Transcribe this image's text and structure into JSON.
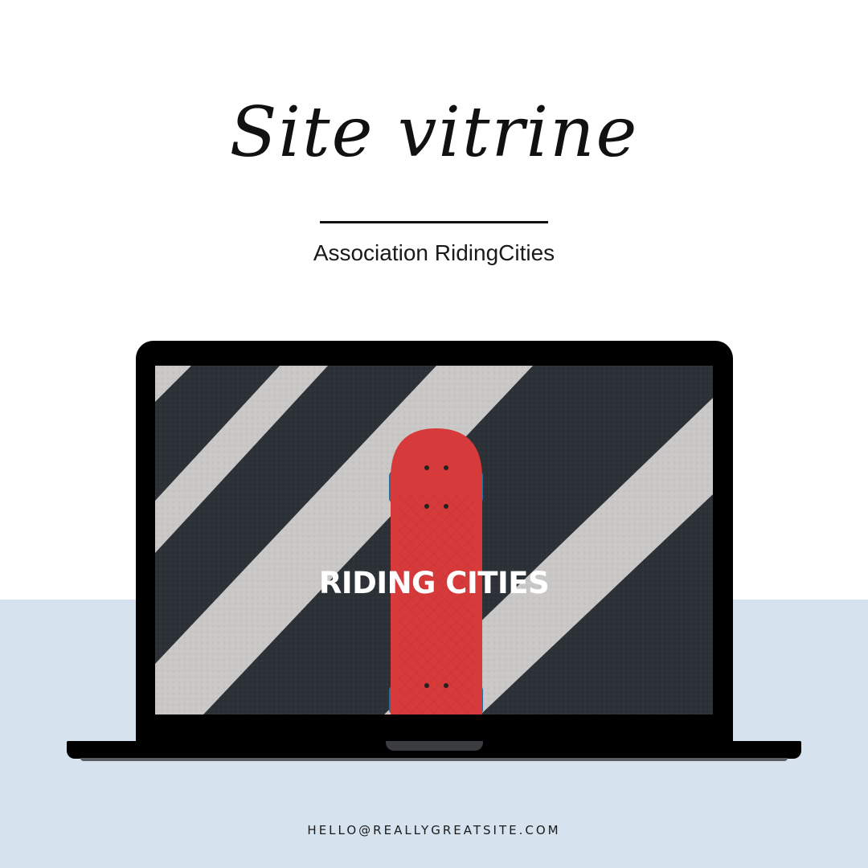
{
  "headline": "Site vitrine",
  "subtitle": "Association RidingCities",
  "screen": {
    "title": "RIDING CITIES",
    "image": "skateboard-on-crosswalk"
  },
  "contact": "HELLO@REALLYGREATSITE.COM",
  "colors": {
    "background_top": "#ffffff",
    "background_bottom": "#d6e3ef",
    "laptop": "#000000",
    "asphalt": "#2c3137",
    "stripe": "#c9c8c6",
    "skateboard": "#d63a3a",
    "wheels": "#2a6f99",
    "text_dark": "#111111",
    "text_light": "#ffffff"
  }
}
